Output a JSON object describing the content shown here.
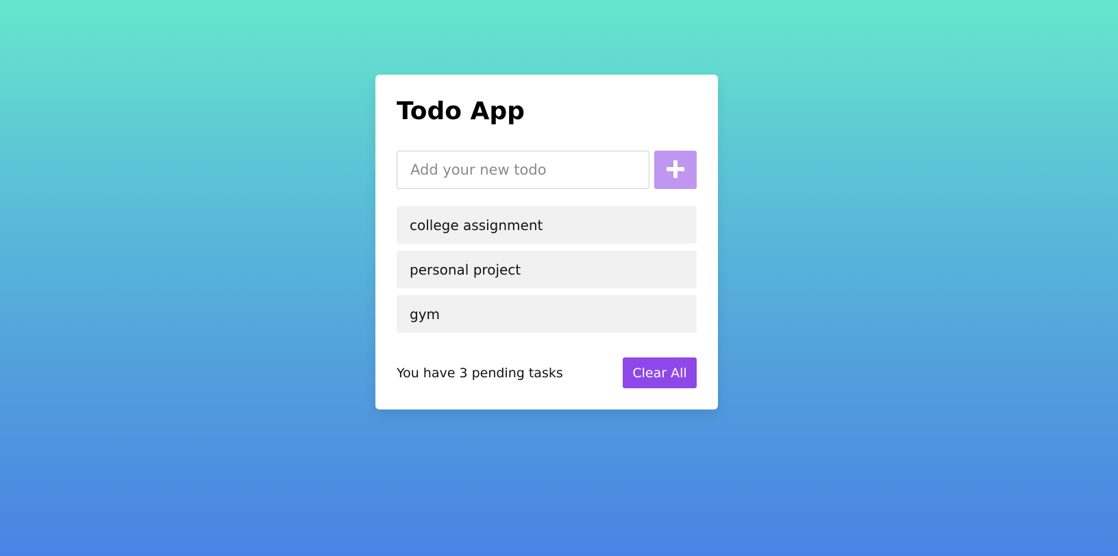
{
  "app": {
    "title": "Todo App"
  },
  "input": {
    "placeholder": "Add your new todo",
    "value": ""
  },
  "add_button": {
    "icon": "plus-icon"
  },
  "todos": [
    {
      "label": "college assignment"
    },
    {
      "label": "personal project"
    },
    {
      "label": "gym"
    }
  ],
  "footer": {
    "pending_text": "You have 3 pending tasks",
    "clear_label": "Clear All"
  },
  "colors": {
    "background_top": "#66e6cc",
    "background_bottom": "#4a83e4",
    "add_button": "#bf96f0",
    "clear_button": "#8e48ea",
    "todo_item_bg": "#f1f1f1"
  }
}
